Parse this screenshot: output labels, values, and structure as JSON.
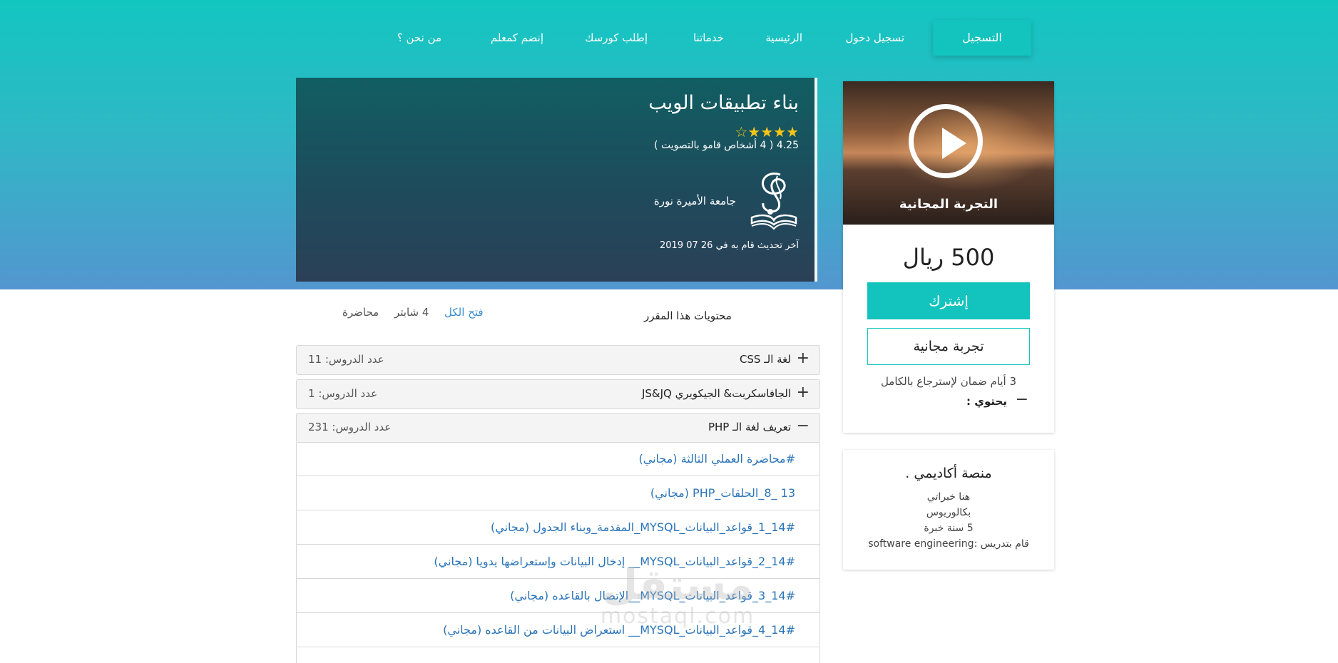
{
  "nav": {
    "register": "التسجيل",
    "links": [
      "تسجيل دخول",
      "الرئيسية",
      "خدماتنا",
      "إطلب كورسك",
      "إنضم كمعلم",
      "من نحن ؟"
    ]
  },
  "course": {
    "title": "بناء تطبيقات الويب",
    "stars": "★★★★☆",
    "rating_text": "4.25 ( 4 أشخاص قامو بالتصويت )",
    "university": "جامعة الأميرة نورة",
    "last_update": "آخر تحديث قام به في 26 07 2019"
  },
  "contents": {
    "title": "محتويات هذا المقرر",
    "expand_all": "فتح الكل",
    "chapters": "4 شابتر",
    "lectures": "محاضرة"
  },
  "sections": [
    {
      "sign": "+",
      "title": "لغة الـ CSS",
      "count": "عدد الدروس: 11"
    },
    {
      "sign": "+",
      "title": "الجافاسكربت& الجيكويري JS&JQ",
      "count": "عدد الدروس: 1"
    },
    {
      "sign": "−",
      "title": "تعريف لغة الـ PHP",
      "count": "عدد الدروس: 231"
    }
  ],
  "lessons": [
    "#محاضرة العملي الثالثة (مجاني)",
    "13 _8_الحلقات_PHP (مجاني)",
    "14#_1_قواعد_البيانات_MYSQL_المقدمة_وبناء الجدول (مجاني)",
    "14#_2_قواعد_البيانات_MYSQL__ إدخال البيانات وإستعراضها يدويا (مجاني)",
    "14#_3_قواعد_البيانات_MYSQL__الإتصال بالقاعده (مجاني)",
    "14#_4_قواعد_البيانات_MYSQL__ استعراض البيانات من القاعده (مجاني)"
  ],
  "pricing": {
    "video_label": "التجربة المجانية",
    "price": "500 ريال",
    "subscribe": "إشترك",
    "free_trial": "تجربة مجانية",
    "guarantee": "3 أيام ضمان لإسترجاع بالكامل",
    "contains": "يحتوي :"
  },
  "instructor": {
    "title": "منصة أكاديمي .",
    "line1": "هنا خبراتي",
    "line2": "بكالوريوس",
    "line3": "5 سنة خبرة",
    "line4": "قام بتدريس :software engineering"
  },
  "watermark": {
    "arabic": "مستقل",
    "latin": "mostaql.com"
  },
  "colors": {
    "accent": "#13c3bd",
    "link": "#2a74b8"
  }
}
